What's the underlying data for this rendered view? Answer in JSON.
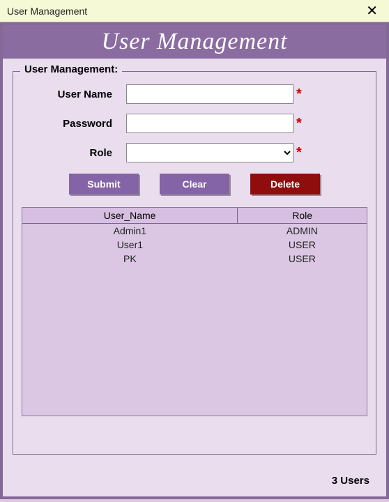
{
  "window": {
    "title": "User Management"
  },
  "banner": {
    "title": "User Management"
  },
  "group": {
    "legend": "User Management:"
  },
  "form": {
    "username_label": "User Name",
    "username_value": "",
    "password_label": "Password",
    "password_value": "",
    "role_label": "Role",
    "role_value": "",
    "asterisk": "*"
  },
  "buttons": {
    "submit": "Submit",
    "clear": "Clear",
    "delete": "Delete"
  },
  "table": {
    "columns": [
      "User_Name",
      "Role"
    ],
    "rows": [
      {
        "user": "Admin1",
        "role": "ADMIN"
      },
      {
        "user": "User1",
        "role": "USER"
      },
      {
        "user": "PK",
        "role": "USER"
      }
    ]
  },
  "status": {
    "count_text": "3 Users"
  }
}
